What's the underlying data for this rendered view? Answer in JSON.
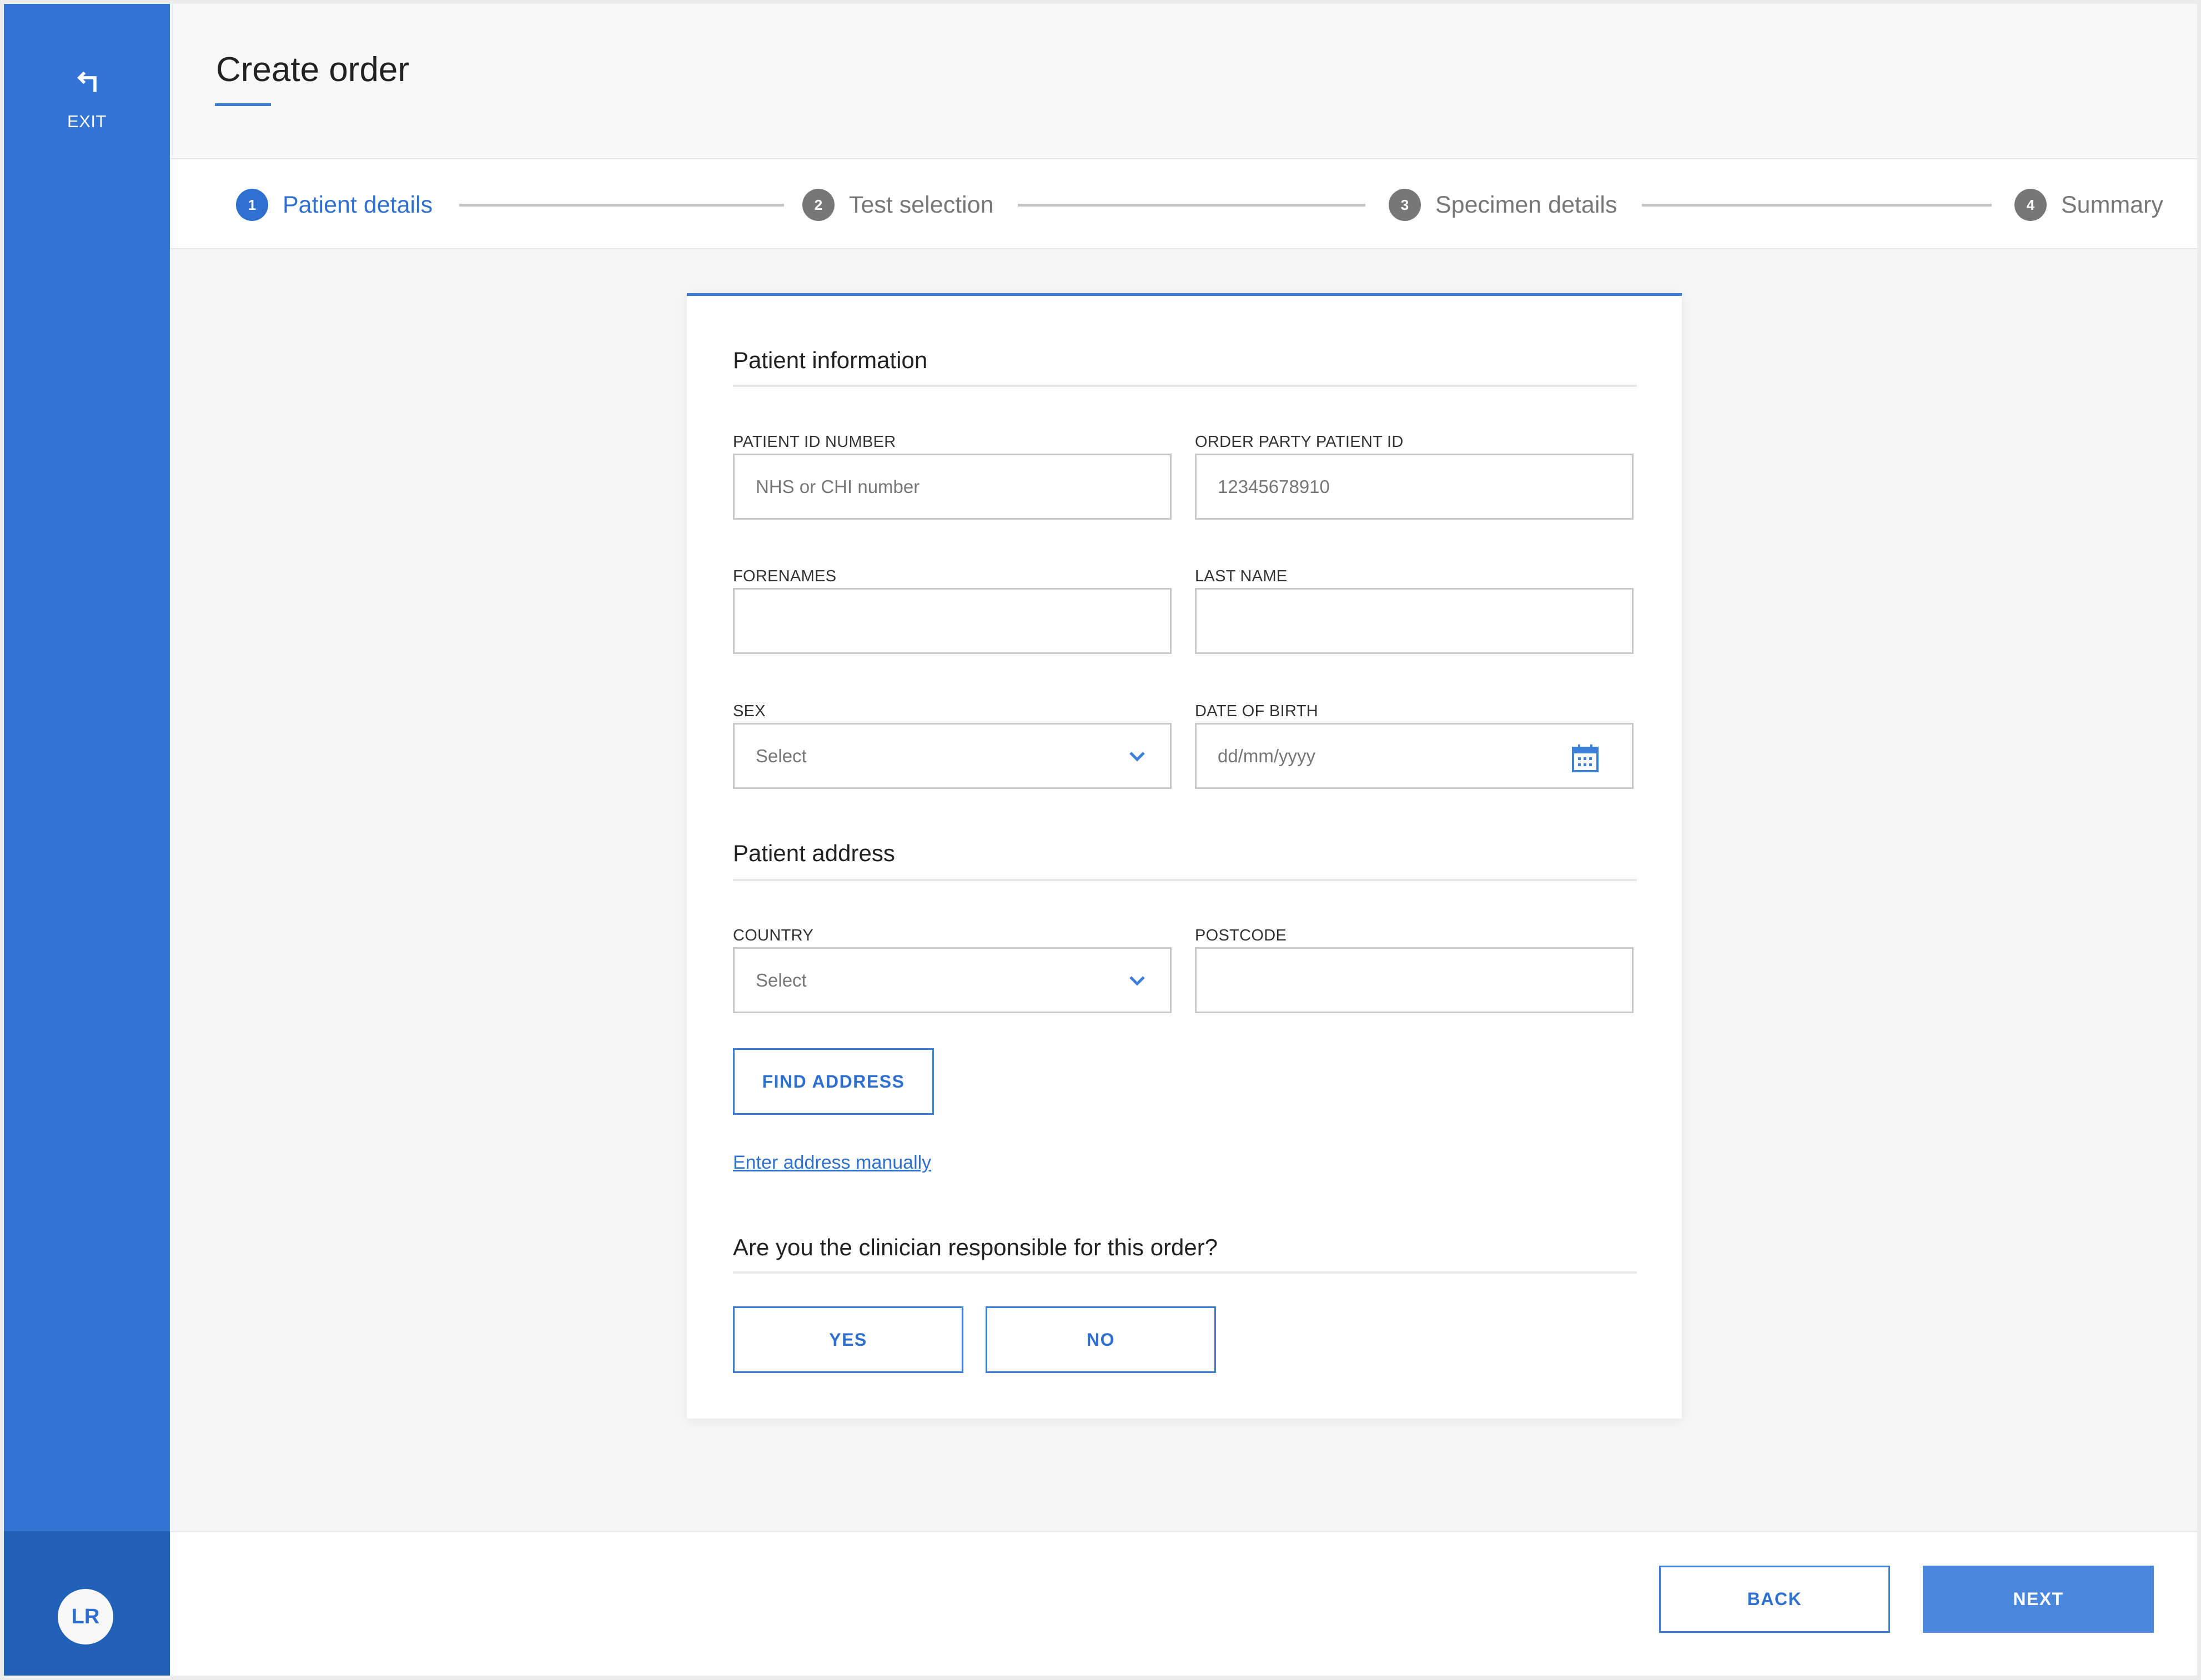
{
  "sidebar": {
    "exit_label": "EXIT",
    "exit_icon": "return-arrow-icon",
    "avatar_initials": "LR"
  },
  "header": {
    "title": "Create order"
  },
  "stepper": {
    "steps": [
      {
        "number": "1",
        "label": "Patient details",
        "active": true
      },
      {
        "number": "2",
        "label": "Test selection",
        "active": false
      },
      {
        "number": "3",
        "label": "Specimen details",
        "active": false
      },
      {
        "number": "4",
        "label": "Summary",
        "active": false
      }
    ]
  },
  "form": {
    "patient_information": {
      "title": "Patient information",
      "patient_id_label": "PATIENT ID NUMBER",
      "patient_id_placeholder": "NHS or CHI number",
      "order_party_id_label": "ORDER PARTY PATIENT ID",
      "order_party_id_placeholder": "12345678910",
      "forenames_label": "FORENAMES",
      "forenames_value": "",
      "last_name_label": "LAST NAME",
      "last_name_value": "",
      "sex_label": "SEX",
      "sex_value": "Select",
      "dob_label": "DATE OF BIRTH",
      "dob_placeholder": "dd/mm/yyyy"
    },
    "patient_address": {
      "title": "Patient address",
      "country_label": "COUNTRY",
      "country_value": "Select",
      "postcode_label": "POSTCODE",
      "postcode_value": "",
      "find_address_label": "FIND ADDRESS",
      "manual_link_label": "Enter address manually"
    },
    "clinician": {
      "question": "Are you the clinician responsible for this order?",
      "yes_label": "YES",
      "no_label": "NO"
    }
  },
  "footer": {
    "back_label": "BACK",
    "next_label": "NEXT"
  },
  "colors": {
    "accent": "#3273d3",
    "sidebar_bottom": "#2261b8",
    "primary_button": "#4a87dc",
    "step_inactive": "#777777"
  }
}
